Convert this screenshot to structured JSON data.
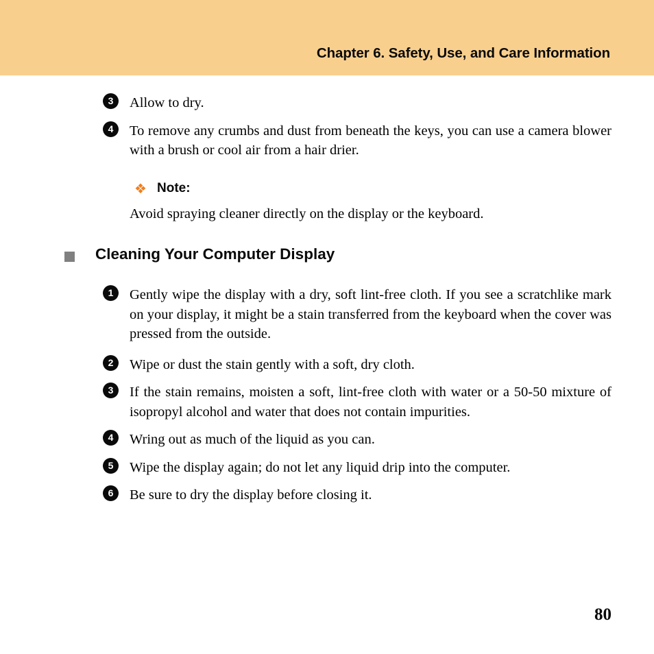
{
  "header": {
    "title": "Chapter 6. Safety, Use, and Care Information",
    "band_color": "#f9cf8e"
  },
  "intro_list": {
    "items": [
      {
        "number": "3",
        "text": "Allow to dry."
      },
      {
        "number": "4",
        "text": "To remove any crumbs and dust from beneath the keys, you can use a camera blower with a brush or cool air from a hair drier."
      }
    ]
  },
  "note": {
    "bullet_glyph": "❖",
    "bullet_color": "#ef8020",
    "label": "Note:",
    "body": "Avoid spraying cleaner directly on the display or the keyboard."
  },
  "section": {
    "bullet_color": "#808080",
    "title": "Cleaning Your Computer Display"
  },
  "steps": {
    "items": [
      {
        "number": "1",
        "text": "Gently wipe the display with a dry, soft lint-free cloth. If you see a scratchlike mark on your display, it might be a stain transferred from the keyboard when the cover was pressed from the outside."
      },
      {
        "number": "2",
        "text": "Wipe or dust the stain gently with a soft, dry cloth."
      },
      {
        "number": "3",
        "text": "If the stain remains, moisten a soft, lint-free cloth with water or a 50-50 mixture of isopropyl alcohol and water that does not contain impurities."
      },
      {
        "number": "4",
        "text": "Wring out as much of the liquid as you can."
      },
      {
        "number": "5",
        "text": "Wipe the display again; do not let any liquid drip into the computer."
      },
      {
        "number": "6",
        "text": "Be sure to dry the display before closing it."
      }
    ]
  },
  "footer": {
    "page_number": "80"
  }
}
